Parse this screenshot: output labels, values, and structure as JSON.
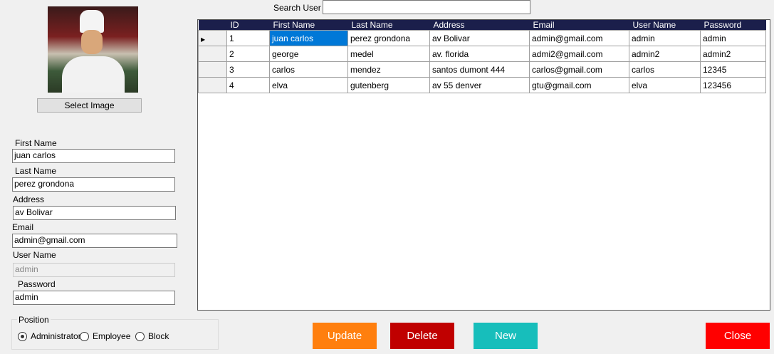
{
  "search": {
    "label": "Search User",
    "value": ""
  },
  "select_image_label": "Select Image",
  "form": {
    "first_name_label": "First Name",
    "first_name": "juan carlos",
    "last_name_label": "Last Name",
    "last_name": "perez grondona",
    "address_label": "Address",
    "address": "av Bolivar",
    "email_label": "Email",
    "email": "admin@gmail.com",
    "username_label": "User Name",
    "username": "admin",
    "password_label": "Password",
    "password": "admin"
  },
  "position": {
    "label": "Position",
    "options": [
      "Administrator",
      "Employee",
      "Block"
    ],
    "selected": "Administrator"
  },
  "table": {
    "columns": [
      "ID",
      "First Name",
      "Last Name",
      "Address",
      "Email",
      "User Name",
      "Password"
    ],
    "rows": [
      [
        "1",
        "juan carlos",
        "perez grondona",
        "av Bolivar",
        "admin@gmail.com",
        "admin",
        "admin"
      ],
      [
        "2",
        "george",
        "medel",
        "av. florida",
        "admi2@gmail.com",
        "admin2",
        "admin2"
      ],
      [
        "3",
        "carlos",
        "mendez",
        "santos dumont 444",
        "carlos@gmail.com",
        "carlos",
        "12345"
      ],
      [
        "4",
        "elva",
        "gutenberg",
        "av 55 denver",
        "gtu@gmail.com",
        "elva",
        "123456"
      ]
    ]
  },
  "buttons": {
    "update": "Update",
    "delete": "Delete",
    "new": "New",
    "close": "Close"
  },
  "colors": {
    "update": "#ff7f0e",
    "delete": "#c00000",
    "new": "#17bebb",
    "close": "#ff0000",
    "header": "#1b1f4b",
    "selection": "#0078d7"
  }
}
